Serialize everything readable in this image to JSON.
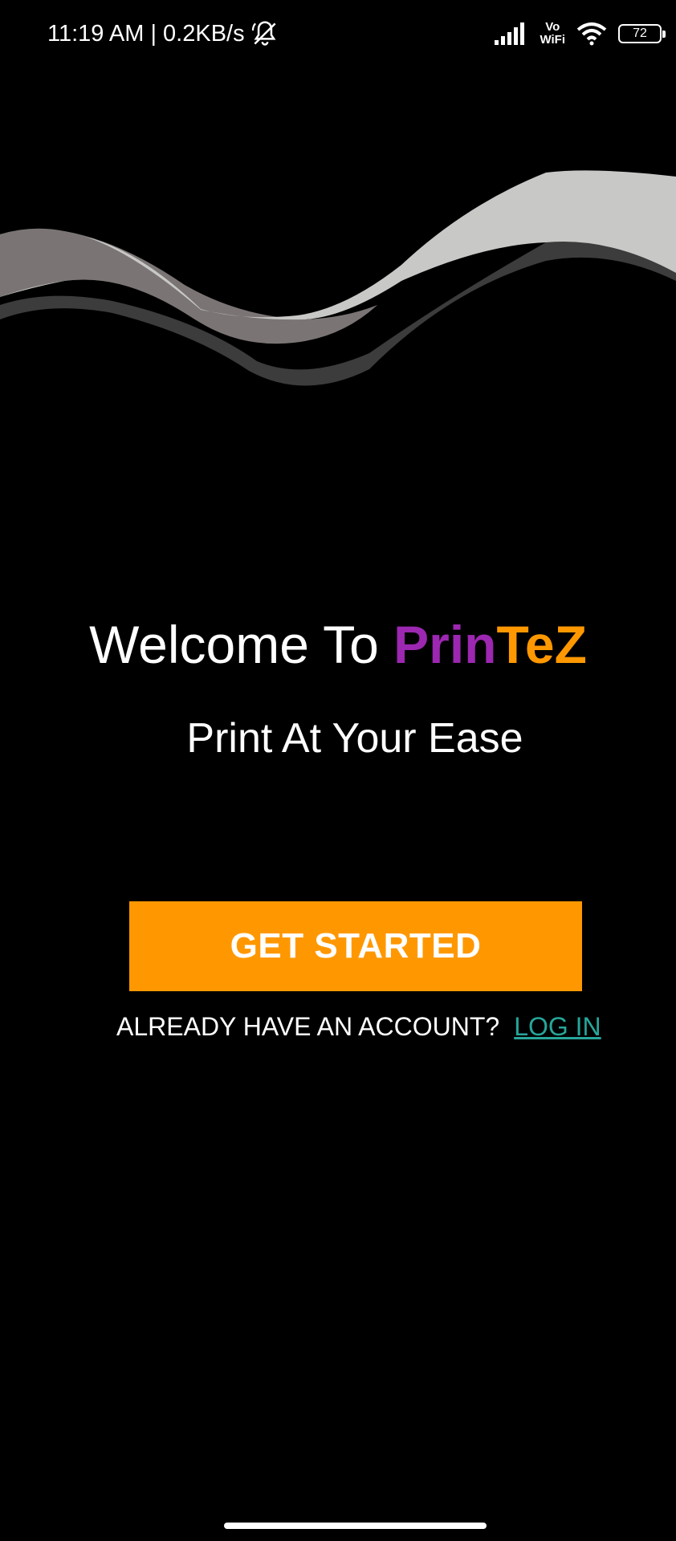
{
  "status_bar": {
    "time": "11:19 AM",
    "separator": " | ",
    "network_speed": "0.2KB/s",
    "vowifi_top": "Vo",
    "vowifi_bottom": "WiFi",
    "battery_level": "72",
    "icons": [
      "mute-bell-icon",
      "signal-icon",
      "vowifi-icon",
      "wifi-icon",
      "battery-icon"
    ]
  },
  "welcome": {
    "prefix": "Welcome To ",
    "brand_part1": "Prin",
    "brand_part2": "TeZ"
  },
  "tagline": "Print At Your Ease",
  "get_started_label": "GET STARTED",
  "login": {
    "prompt": "ALREADY HAVE AN ACCOUNT?",
    "link_label": "LOG IN"
  },
  "colors": {
    "background": "#000000",
    "brand_purple": "#9c27b0",
    "brand_orange": "#ff9800",
    "button": "#ff9800",
    "link": "#26a69a",
    "wave_light": "#c8c8c6",
    "wave_mid": "#7a7574",
    "wave_dark": "#3c3c3c"
  }
}
